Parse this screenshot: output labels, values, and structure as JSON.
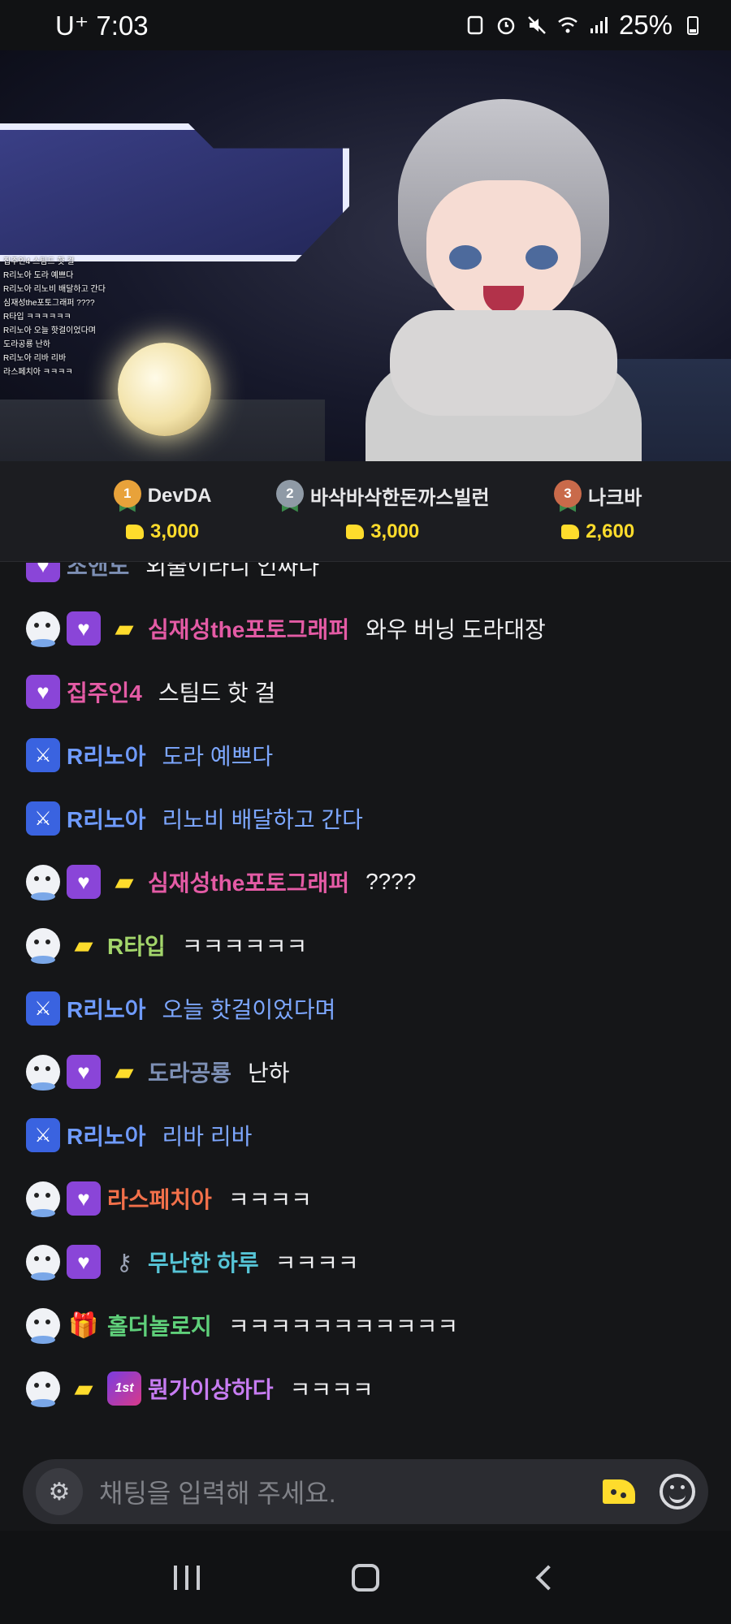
{
  "status_bar": {
    "carrier_time": "U⁺ 7:03",
    "battery": "25%"
  },
  "stream_overlay_chat": [
    "집주인4 스팀드 핫 걸",
    "R리노아 도라 예쁘다",
    "R리노아 리노비 배달하고 간다",
    "심재성the포토그래퍼 ????",
    "R타입 ㅋㅋㅋㅋㅋㅋ",
    "R리노아 오늘 핫걸이었다며",
    "도라공룡 난하",
    "R리노아 리바 리바",
    "라스페치아 ㅋㅋㅋㅋ"
  ],
  "ranking": [
    {
      "rank": "1",
      "name": "DevDA",
      "amount": "3,000",
      "color": "#e8a23a"
    },
    {
      "rank": "2",
      "name": "바삭바삭한돈까스빌런",
      "amount": "3,000",
      "color": "#8f9aa6"
    },
    {
      "rank": "3",
      "name": "나크바",
      "amount": "2,600",
      "color": "#c96a4a"
    }
  ],
  "chat": [
    {
      "badges": [
        "heart"
      ],
      "nick": "조앤도",
      "nick_color": "#7d8fb4",
      "msg": "외출이라니 인싸다",
      "msg_style": "normal"
    },
    {
      "badges": [
        "ghost",
        "heart",
        "cheese"
      ],
      "nick": "심재성the포토그래퍼",
      "nick_color": "#e45ba5",
      "msg": "와우 버닝 도라대장",
      "msg_style": "normal"
    },
    {
      "badges": [
        "heart"
      ],
      "nick": "집주인4",
      "nick_color": "#e45ba5",
      "msg": "스팀드 핫 걸",
      "msg_style": "normal"
    },
    {
      "badges": [
        "sword"
      ],
      "nick": "R리노아",
      "nick_color": "#6f9bff",
      "msg": "도라 예쁘다",
      "msg_style": "blue"
    },
    {
      "badges": [
        "sword"
      ],
      "nick": "R리노아",
      "nick_color": "#6f9bff",
      "msg": "리노비 배달하고 간다",
      "msg_style": "blue"
    },
    {
      "badges": [
        "ghost",
        "heart",
        "cheese"
      ],
      "nick": "심재성the포토그래퍼",
      "nick_color": "#e45ba5",
      "msg": "????",
      "msg_style": "normal"
    },
    {
      "badges": [
        "ghost",
        "cheese"
      ],
      "nick": "R타입",
      "nick_color": "#a3d66b",
      "msg": "ㅋㅋㅋㅋㅋㅋ",
      "msg_style": "normal"
    },
    {
      "badges": [
        "sword"
      ],
      "nick": "R리노아",
      "nick_color": "#6f9bff",
      "msg": "오늘 핫걸이었다며",
      "msg_style": "blue"
    },
    {
      "badges": [
        "ghost",
        "heart",
        "cheese"
      ],
      "nick": "도라공룡",
      "nick_color": "#7d8fb4",
      "msg": "난하",
      "msg_style": "normal"
    },
    {
      "badges": [
        "sword"
      ],
      "nick": "R리노아",
      "nick_color": "#6f9bff",
      "msg": "리바 리바",
      "msg_style": "blue"
    },
    {
      "badges": [
        "ghost",
        "heart"
      ],
      "nick": "라스페치아",
      "nick_color": "#f2704a",
      "msg": "ㅋㅋㅋㅋ",
      "msg_style": "normal"
    },
    {
      "badges": [
        "ghost",
        "heart",
        "key"
      ],
      "nick": "무난한 하루",
      "nick_color": "#56c4d6",
      "msg": "ㅋㅋㅋㅋ",
      "msg_style": "normal"
    },
    {
      "badges": [
        "ghost",
        "gift"
      ],
      "nick": "홀더놀로지",
      "nick_color": "#5fd07a",
      "msg": "ㅋㅋㅋㅋㅋㅋㅋㅋㅋㅋㅋ",
      "msg_style": "normal"
    },
    {
      "badges": [
        "ghost",
        "cheese",
        "1st"
      ],
      "nick": "뭔가이상하다",
      "nick_color": "#c77cf2",
      "msg": "ㅋㅋㅋㅋ",
      "msg_style": "normal"
    }
  ],
  "input": {
    "placeholder": "채팅을 입력해 주세요."
  },
  "icons": {
    "settings": "gear-icon",
    "cheese_donation": "cheese-icon",
    "emoji": "emoji-icon"
  }
}
